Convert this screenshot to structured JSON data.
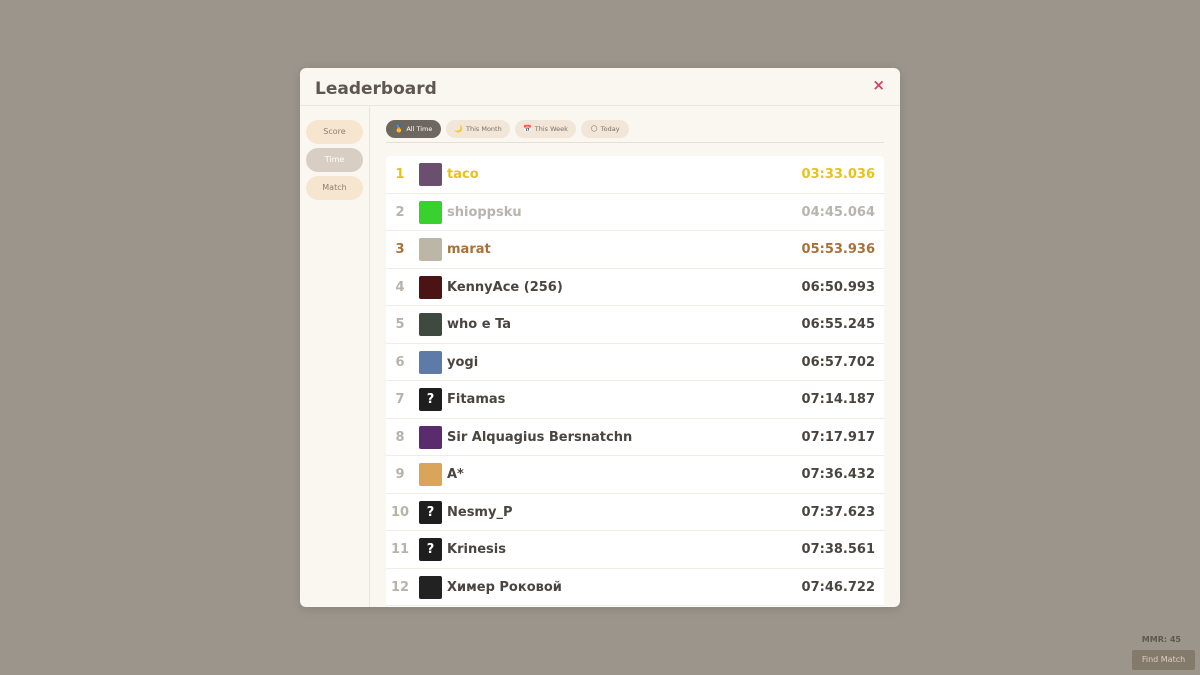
{
  "modal": {
    "title": "Leaderboard",
    "close_label": "×"
  },
  "sidebar": {
    "tabs": [
      {
        "label": "Score",
        "active": false
      },
      {
        "label": "Time",
        "active": true
      },
      {
        "label": "Match",
        "active": false
      }
    ]
  },
  "filters": [
    {
      "icon": "🥇",
      "label": "All Time",
      "active": true
    },
    {
      "icon": "🌙",
      "label": "This Month",
      "active": false
    },
    {
      "icon": "📅",
      "label": "This Week",
      "active": false
    },
    {
      "icon": "🌕",
      "label": "Today",
      "active": false
    }
  ],
  "leaderboard": [
    {
      "rank": "1",
      "name": "taco",
      "time": "03:33.036",
      "tier": "gold",
      "avatar": "#6b4f6f"
    },
    {
      "rank": "2",
      "name": "shioppsku",
      "time": "04:45.064",
      "tier": "silver",
      "avatar": "#38d12d"
    },
    {
      "rank": "3",
      "name": "marat",
      "time": "05:53.936",
      "tier": "bronze",
      "avatar": "#bcb6a6"
    },
    {
      "rank": "4",
      "name": "KennyAce (256)",
      "time": "06:50.993",
      "tier": "",
      "avatar": "#4a1414"
    },
    {
      "rank": "5",
      "name": "who e Ta",
      "time": "06:55.245",
      "tier": "",
      "avatar": "#3e4a40"
    },
    {
      "rank": "6",
      "name": "yogi",
      "time": "06:57.702",
      "tier": "",
      "avatar": "#5d7aa8"
    },
    {
      "rank": "7",
      "name": "Fitamas",
      "time": "07:14.187",
      "tier": "",
      "avatar": "unknown"
    },
    {
      "rank": "8",
      "name": "Sir Alquagius Bersnatchn",
      "time": "07:17.917",
      "tier": "",
      "avatar": "#5a2c6e"
    },
    {
      "rank": "9",
      "name": "A*",
      "time": "07:36.432",
      "tier": "",
      "avatar": "#d9a55a"
    },
    {
      "rank": "10",
      "name": "Nesmy_P",
      "time": "07:37.623",
      "tier": "",
      "avatar": "unknown"
    },
    {
      "rank": "11",
      "name": "Krinesis",
      "time": "07:38.561",
      "tier": "",
      "avatar": "unknown"
    },
    {
      "rank": "12",
      "name": "Химер Роковой",
      "time": "07:46.722",
      "tier": "",
      "avatar": "#222222"
    }
  ],
  "footer": {
    "mmr": "MMR: 45",
    "find_match": "Find Match"
  }
}
